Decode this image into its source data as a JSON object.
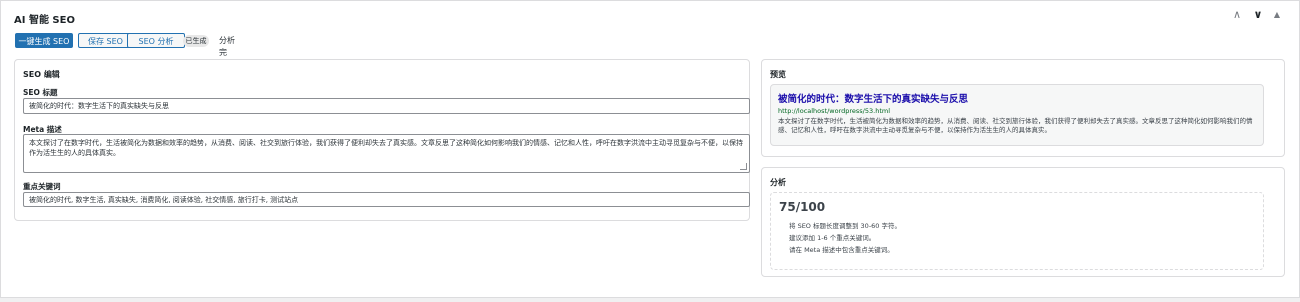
{
  "panel": {
    "title": "AI 智能 SEO"
  },
  "header_controls": {
    "up": "∧",
    "down": "∨",
    "toggle": "▲"
  },
  "toolbar": {
    "generate_label": "一键生成 SEO",
    "save_label": "保存 SEO",
    "analyze_label": "SEO 分析",
    "badge": "已生成",
    "status": "分析完成。"
  },
  "editor": {
    "title": "SEO 编辑",
    "seo_title_label": "SEO 标题",
    "seo_title_value": "被简化的时代：数字生活下的真实缺失与反思",
    "meta_label": "Meta 描述",
    "meta_value": "本文探讨了在数字时代，生活被简化为数据和效率的趋势，从消费、阅读、社交到旅行体验，我们获得了便利却失去了真实感。文章反思了这种简化如何影响我们的情感、记忆和人性，呼吁在数字洪流中主动寻觅复杂与不便，以保持作为活生生的人的具体真实。",
    "keywords_label": "重点关键词",
    "keywords_value": "被简化的时代, 数字生活, 真实缺失, 消费简化, 阅读体验, 社交情感, 旅行打卡, 测试站点"
  },
  "preview": {
    "title": "预览",
    "serp_title": "被简化的时代：数字生活下的真实缺失与反思",
    "serp_url": "http://localhost/wordpress/53.html",
    "serp_desc": "本文探讨了在数字时代，生活被简化为数据和效率的趋势，从消费、阅读、社交到旅行体验，我们获得了便利却失去了真实感。文章反思了这种简化如何影响我们的情感、记忆和人性，呼吁在数字洪流中主动寻觅复杂与不便，以保持作为活生生的人的具体真实。"
  },
  "analysis": {
    "title": "分析",
    "score": "75/100",
    "tips": [
      "将 SEO 标题长度调整到 30-60 字符。",
      "建议添加 1-6 个重点关键词。",
      "请在 Meta 描述中包含重点关键词。"
    ]
  },
  "colors": {
    "accent": "#2271b1",
    "serp_title": "#1a0dab",
    "serp_url": "#006621"
  }
}
